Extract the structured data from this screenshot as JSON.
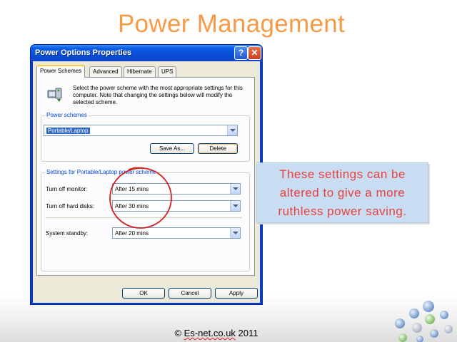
{
  "slide": {
    "title": "Power Management",
    "callout": [
      "These settings can be",
      "altered to give a more",
      "ruthless power saving."
    ],
    "footer_prefix": "© ",
    "footer_site": "Es-net.co.uk",
    "footer_year": " 2011"
  },
  "dialog": {
    "title": "Power Options Properties",
    "help_glyph": "?",
    "close_glyph": "✕",
    "tabs": [
      "Power Schemes",
      "Advanced",
      "Hibernate",
      "UPS"
    ],
    "intro": "Select the power scheme with the most appropriate settings for this computer. Note that changing the settings below will modify the selected scheme.",
    "schemes_group": {
      "label": "Power schemes",
      "selected": "Portable/Laptop",
      "save_as": "Save As...",
      "delete": "Delete"
    },
    "settings_group": {
      "label": "Settings for Portable/Laptop power scheme",
      "rows": [
        {
          "label": "Turn off monitor:",
          "value": "After 15 mins"
        },
        {
          "label": "Turn off hard disks:",
          "value": "After 30 mins"
        },
        {
          "label": "System standby:",
          "value": "After 20 mins"
        }
      ]
    },
    "buttons": {
      "ok": "OK",
      "cancel": "Cancel",
      "apply": "Apply"
    }
  },
  "colors": {
    "title_orange": "#f79a45",
    "callout_text": "#e8403c",
    "annotation_ring": "#d42020",
    "xp_titlebar": "#0a4fd6"
  }
}
